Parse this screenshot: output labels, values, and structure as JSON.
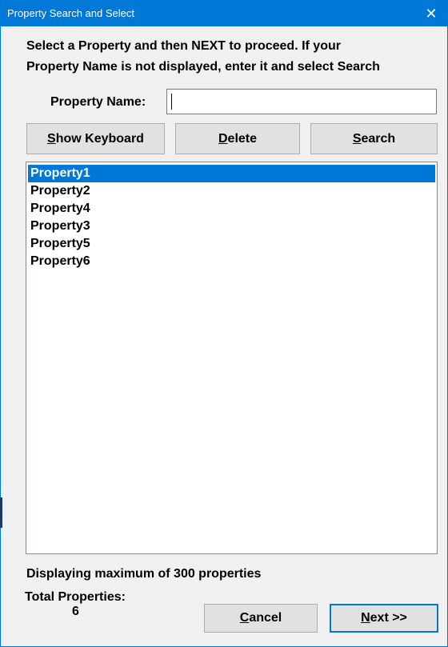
{
  "window": {
    "title": "Property Search and Select",
    "close_glyph": "✕"
  },
  "instructions": {
    "line1": "Select a Property and then NEXT to proceed. If your",
    "line2": "Property Name is not displayed, enter it and select Search"
  },
  "search": {
    "label": "Property Name:",
    "value": ""
  },
  "buttons": {
    "show_keyboard": {
      "mnemonic": "S",
      "rest": "how Keyboard"
    },
    "delete": {
      "mnemonic": "D",
      "rest": "elete"
    },
    "search": {
      "mnemonic": "S",
      "rest": "earch"
    },
    "cancel": {
      "mnemonic": "C",
      "rest": "ancel"
    },
    "next": {
      "mnemonic": "N",
      "rest": "ext >>"
    }
  },
  "properties": {
    "selected_index": 0,
    "items": [
      "Property1",
      "Property2",
      "Property4",
      "Property3",
      "Property5",
      "Property6"
    ]
  },
  "footer": {
    "note": "Displaying maximum of 300 properties",
    "total_label": "Total Properties:",
    "total_value": "6"
  },
  "colors": {
    "accent": "#0078d7",
    "selected_text": "#ffffff"
  }
}
